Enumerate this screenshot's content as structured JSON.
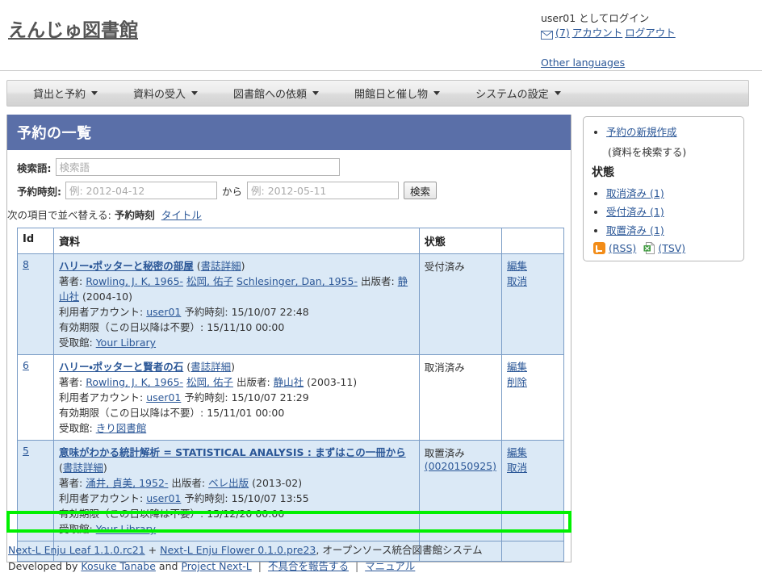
{
  "header": {
    "site_title": "えんじゅ図書館",
    "login_text": "user01 としてログイン",
    "mail_icon": "envelope-icon",
    "message_count": "(7)",
    "account_link": "アカウント",
    "logout_link": "ログアウト",
    "other_languages": "Other languages"
  },
  "menu": {
    "items": [
      {
        "label": "貸出と予約"
      },
      {
        "label": "資料の受入"
      },
      {
        "label": "図書館への依頼"
      },
      {
        "label": "開館日と催し物"
      },
      {
        "label": "システムの設定"
      }
    ]
  },
  "main": {
    "title": "予約の一覧",
    "search": {
      "query_label": "検索語:",
      "query_value": "",
      "query_placeholder": "検索語",
      "date_label": "予約時刻:",
      "date_from_value": "",
      "date_from_placeholder": "例: 2012-04-12",
      "between_label": "から",
      "date_to_value": "",
      "date_to_placeholder": "例: 2012-05-11",
      "submit_label": "検索"
    },
    "sort": {
      "prefix": "次の項目で並べ替える:",
      "current": "予約時刻",
      "alternate": "タイトル"
    },
    "table": {
      "headers": {
        "id": "Id",
        "material": "資料",
        "status": "状態",
        "actions": ""
      },
      "rows": [
        {
          "id": "8",
          "title": "ハリー・ポッターと秘密の部屋",
          "detail_link": "書誌詳細",
          "author_label": "著者:",
          "authors": [
            "Rowling, J. K, 1965-",
            "松岡, 佑子",
            "Schlesinger, Dan, 1955-"
          ],
          "publisher_label": "出版者:",
          "publisher": "静山社",
          "pubdate": "(2004-10)",
          "account_label": "利用者アカウント:",
          "account": "user01",
          "reserved_label": "予約時刻:",
          "reserved_at": "15/10/07 22:48",
          "expire_label": "有効期限（この日以降は不要）:",
          "expire_at": "15/11/10 00:00",
          "pickup_label": "受取館:",
          "pickup": "Your Library",
          "status": "受付済み",
          "status_code": "",
          "actions": [
            "編集",
            "取消"
          ]
        },
        {
          "id": "6",
          "title": "ハリー・ポッターと賢者の石",
          "detail_link": "書誌詳細",
          "author_label": "著者:",
          "authors": [
            "Rowling, J. K, 1965-",
            "松岡, 佑子"
          ],
          "publisher_label": "出版者:",
          "publisher": "静山社",
          "pubdate": "(2003-11)",
          "account_label": "利用者アカウント:",
          "account": "user01",
          "reserved_label": "予約時刻:",
          "reserved_at": "15/10/07 21:29",
          "expire_label": "有効期限（この日以降は不要）:",
          "expire_at": "15/11/01 00:00",
          "pickup_label": "受取館:",
          "pickup": "きり図書館",
          "status": "取消済み",
          "status_code": "",
          "actions": [
            "編集",
            "削除"
          ]
        },
        {
          "id": "5",
          "title": "意味がわかる統計解析 = STATISTICAL ANALYSIS : まずはこの一冊から",
          "detail_link": "書誌詳細",
          "author_label": "著者:",
          "authors": [
            "涌井, 貞美, 1952-"
          ],
          "publisher_label": "出版者:",
          "publisher": "ベレ出版",
          "pubdate": "(2013-02)",
          "account_label": "利用者アカウント:",
          "account": "user01",
          "reserved_label": "予約時刻:",
          "reserved_at": "15/10/07 13:55",
          "expire_label": "有効期限（この日以降は不要）:",
          "expire_at": "15/12/20 00:00",
          "pickup_label": "受取館:",
          "pickup": "Your Library",
          "status": "取置済み",
          "status_code": "(0020150925)",
          "actions": [
            "編集",
            "取消"
          ]
        }
      ]
    }
  },
  "sidebar": {
    "new_reserve": "予約の新規作成",
    "new_reserve_note": "(資料を検索する)",
    "state_heading": "状態",
    "states": [
      {
        "label": "取消済み",
        "count": "(1)"
      },
      {
        "label": "受付済み",
        "count": "(1)"
      },
      {
        "label": "取置済み",
        "count": "(1)"
      }
    ],
    "feeds": {
      "rss_icon": "rss-icon",
      "rss_label": "(RSS)",
      "tsv_icon": "spreadsheet-icon",
      "tsv_label": "(TSV)"
    }
  },
  "footer": {
    "leaf": "Next-L Enju Leaf 1.1.0.rc21",
    "plus": "+",
    "flower": "Next-L Enju Flower 0.1.0.pre23",
    "tagline": ", オープンソース統合図書館システム",
    "developed_by": "Developed by",
    "author": "Kosuke Tanabe",
    "and": "and",
    "project": "Project Next-L",
    "bug_report": "不具合を報告する",
    "manual": "マニュアル"
  },
  "annotation": {
    "highlight_color": "#00f000"
  }
}
